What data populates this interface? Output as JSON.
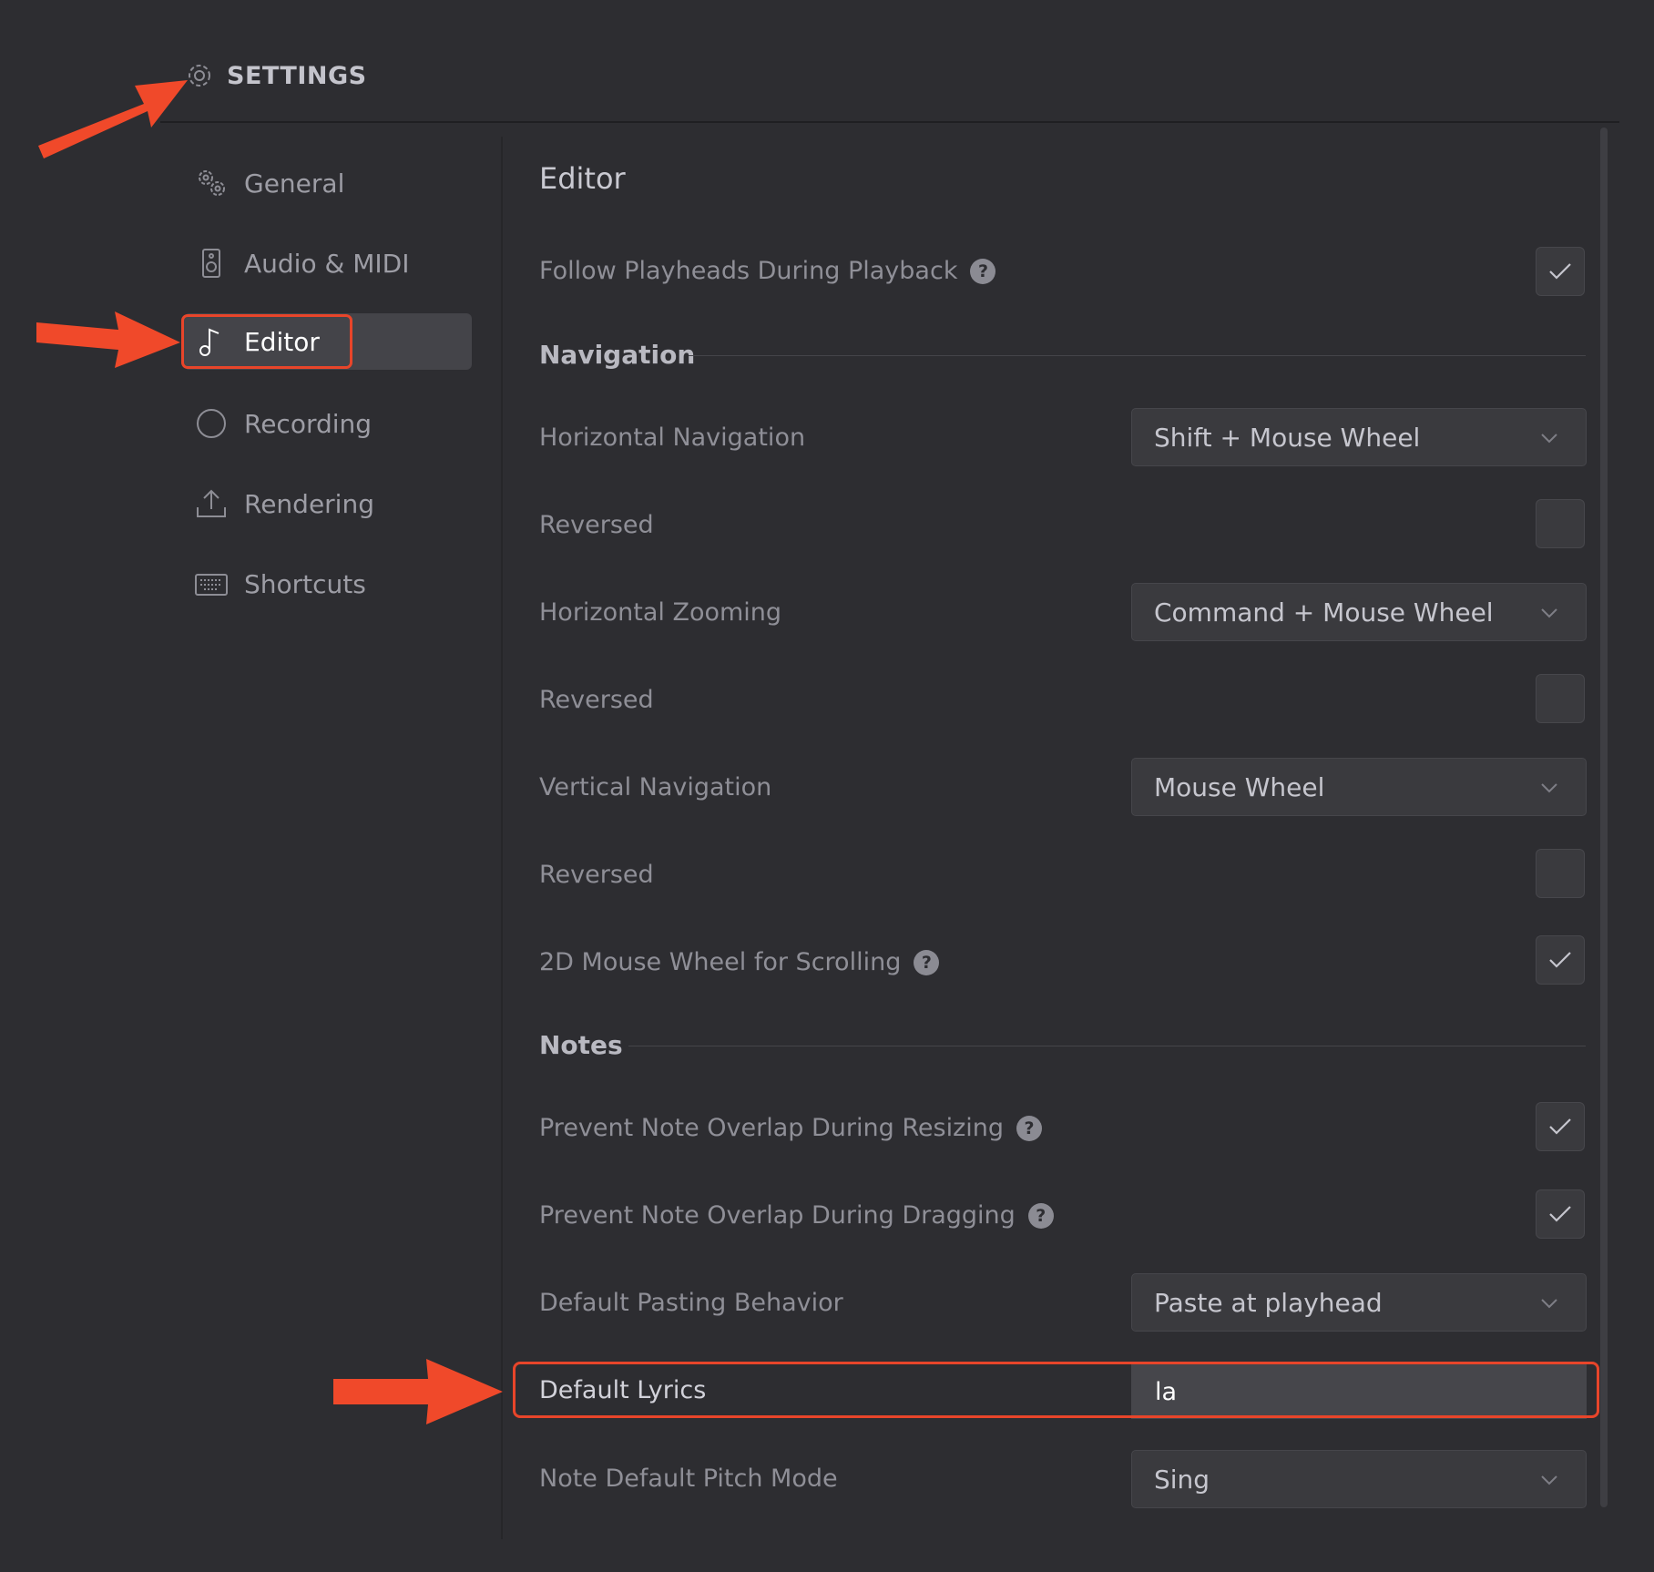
{
  "header": {
    "title": "SETTINGS"
  },
  "sidebar": {
    "items": [
      {
        "label": "General",
        "icon": "gears-icon"
      },
      {
        "label": "Audio & MIDI",
        "icon": "speaker-icon"
      },
      {
        "label": "Editor",
        "icon": "music-note-icon",
        "active": true
      },
      {
        "label": "Recording",
        "icon": "circle-icon"
      },
      {
        "label": "Rendering",
        "icon": "upload-icon"
      },
      {
        "label": "Shortcuts",
        "icon": "keyboard-icon"
      }
    ]
  },
  "main": {
    "title": "Editor",
    "follow_playheads": {
      "label": "Follow Playheads During Playback",
      "checked": true
    },
    "navigation": {
      "title": "Navigation",
      "horizontal_navigation": {
        "label": "Horizontal Navigation",
        "value": "Shift + Mouse Wheel"
      },
      "horizontal_navigation_reversed": {
        "label": "Reversed",
        "checked": false
      },
      "horizontal_zooming": {
        "label": "Horizontal Zooming",
        "value": "Command + Mouse Wheel"
      },
      "horizontal_zooming_reversed": {
        "label": "Reversed",
        "checked": false
      },
      "vertical_navigation": {
        "label": "Vertical Navigation",
        "value": "Mouse Wheel"
      },
      "vertical_navigation_reversed": {
        "label": "Reversed",
        "checked": false
      },
      "mouse_wheel_2d": {
        "label": "2D Mouse Wheel for Scrolling",
        "checked": true
      }
    },
    "notes": {
      "title": "Notes",
      "prevent_overlap_resizing": {
        "label": "Prevent Note Overlap During Resizing",
        "checked": true
      },
      "prevent_overlap_dragging": {
        "label": "Prevent Note Overlap During Dragging",
        "checked": true
      },
      "default_pasting": {
        "label": "Default Pasting Behavior",
        "value": "Paste at playhead"
      },
      "default_lyrics": {
        "label": "Default Lyrics",
        "value": "la"
      },
      "note_pitch_mode": {
        "label": "Note Default Pitch Mode",
        "value": "Sing"
      }
    }
  },
  "help_glyph": "?",
  "colors": {
    "accent": "#e8452a",
    "background": "#2d2d31",
    "active_item": "#444449"
  }
}
